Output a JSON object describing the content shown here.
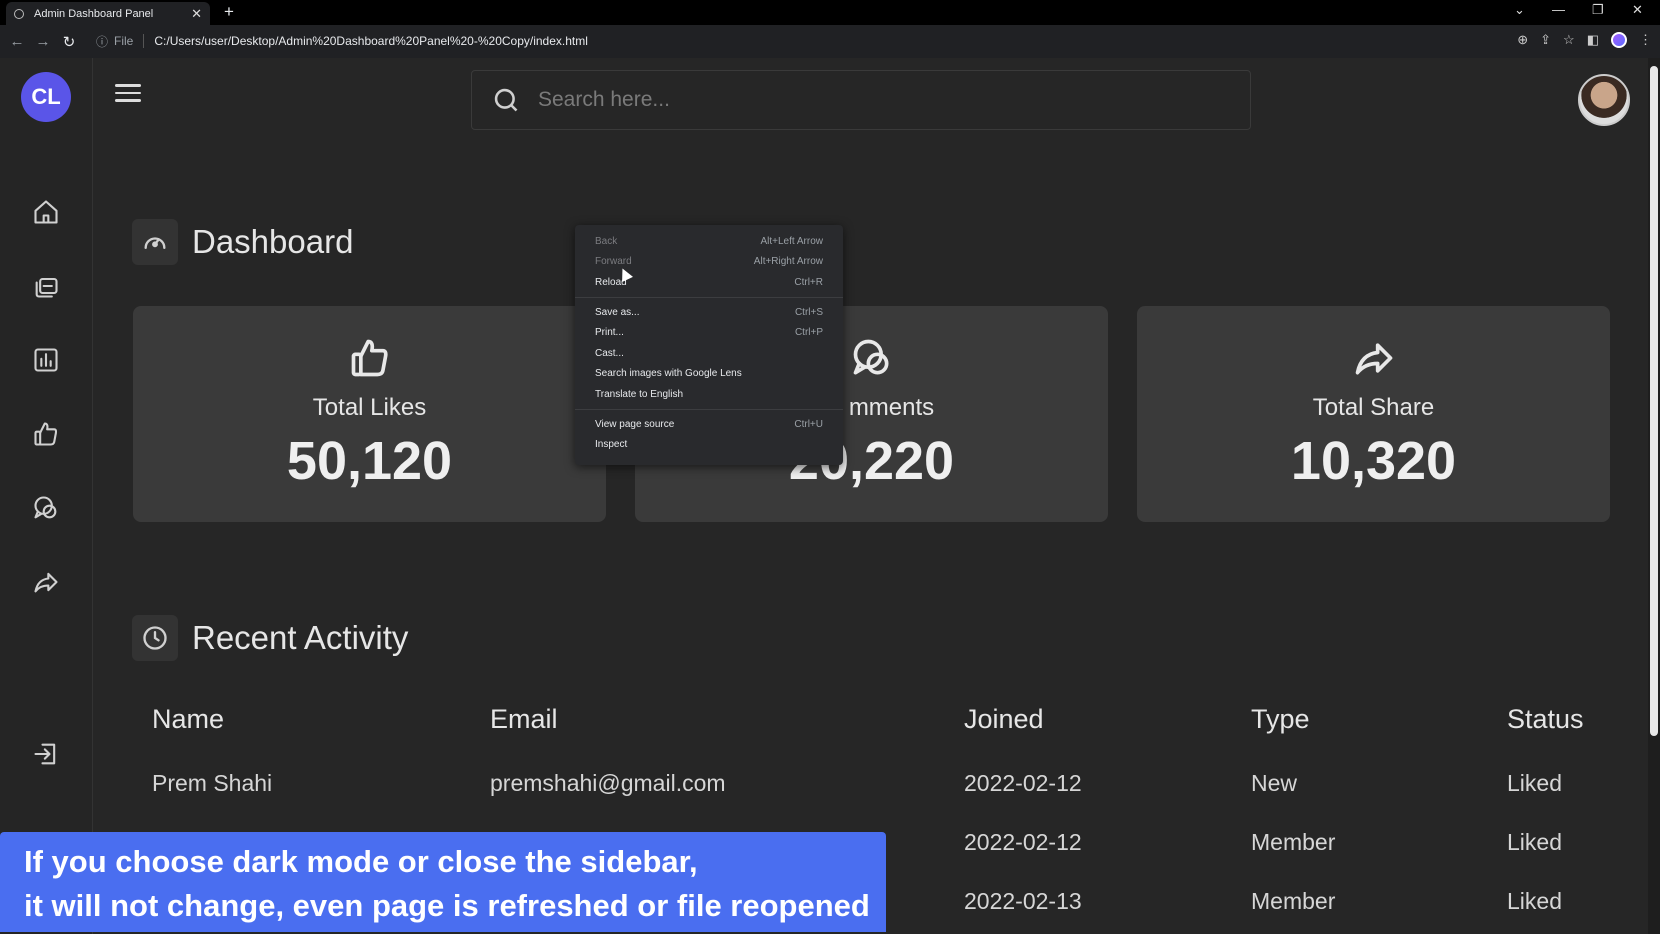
{
  "browser": {
    "tab_title": "Admin Dashboard Panel",
    "tab_close": "✕",
    "new_tab": "+",
    "url_scheme": "File",
    "url": "C:/Users/user/Desktop/Admin%20Dashboard%20Panel%20-%20Copy/index.html",
    "nav": {
      "back": "←",
      "forward": "→",
      "reload": "↻"
    },
    "window": {
      "chevron": "⌄",
      "minimize": "—",
      "restore": "❐",
      "close": "✕"
    }
  },
  "sidebar": {
    "logo_text": "CL",
    "items": [
      {
        "icon": "home-icon"
      },
      {
        "icon": "files-icon"
      },
      {
        "icon": "chart-icon"
      },
      {
        "icon": "thumbs-up-icon"
      },
      {
        "icon": "comments-icon"
      },
      {
        "icon": "share-icon"
      },
      {
        "icon": "logout-icon"
      }
    ]
  },
  "search": {
    "placeholder": "Search here..."
  },
  "dashboard": {
    "title": "Dashboard",
    "cards": [
      {
        "icon": "thumbs-up-icon",
        "label": "Total Likes",
        "value": "50,120"
      },
      {
        "icon": "comments-icon",
        "label": "mments",
        "value": "20,220"
      },
      {
        "icon": "share-icon",
        "label": "Total Share",
        "value": "10,320"
      }
    ]
  },
  "activity": {
    "title": "Recent Activity",
    "columns": [
      "Name",
      "Email",
      "Joined",
      "Type",
      "Status"
    ],
    "rows": [
      [
        "Prem Shahi",
        "premshahi@gmail.com",
        "2022-02-12",
        "New",
        "Liked"
      ],
      [
        "",
        "",
        "2022-02-12",
        "Member",
        "Liked"
      ],
      [
        "",
        "",
        "2022-02-13",
        "Member",
        "Liked"
      ]
    ]
  },
  "context_menu": {
    "items": [
      {
        "label": "Back",
        "shortcut": "Alt+Left Arrow",
        "disabled": true
      },
      {
        "label": "Forward",
        "shortcut": "Alt+Right Arrow",
        "disabled": true
      },
      {
        "label": "Reload",
        "shortcut": "Ctrl+R",
        "disabled": false
      },
      {
        "label": "Save as...",
        "shortcut": "Ctrl+S",
        "disabled": false
      },
      {
        "label": "Print...",
        "shortcut": "Ctrl+P",
        "disabled": false
      },
      {
        "label": "Cast...",
        "shortcut": "",
        "disabled": false
      },
      {
        "label": "Search images with Google Lens",
        "shortcut": "",
        "disabled": false
      },
      {
        "label": "Translate to English",
        "shortcut": "",
        "disabled": false
      },
      {
        "label": "View page source",
        "shortcut": "Ctrl+U",
        "disabled": false
      },
      {
        "label": "Inspect",
        "shortcut": "",
        "disabled": false
      }
    ]
  },
  "banner": {
    "line1": "If you choose dark mode or close the sidebar,",
    "line2": "it will not change, even page is refreshed or file reopened"
  },
  "colors": {
    "accent": "#5a55e8",
    "banner": "#4a6ef0",
    "background": "#262626",
    "card": "#3a3a3a"
  }
}
